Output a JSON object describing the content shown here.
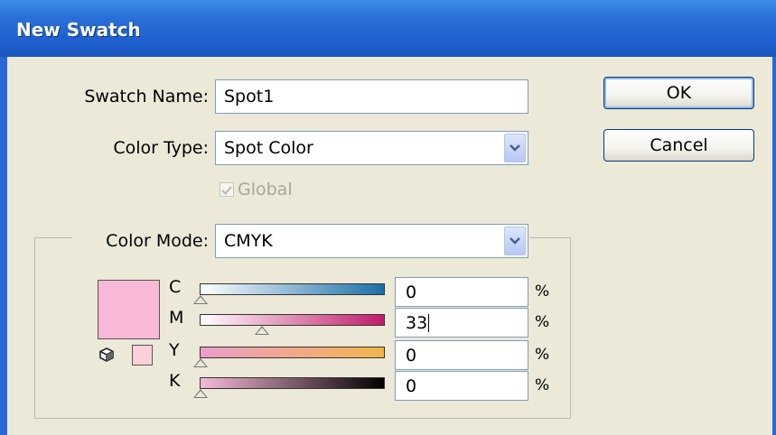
{
  "dialog": {
    "title": "New Swatch"
  },
  "swatch_name": {
    "label": "Swatch Name:",
    "value": "Spot1"
  },
  "color_type": {
    "label": "Color Type:",
    "value": "Spot Color"
  },
  "global": {
    "label": "Global",
    "checked": true,
    "enabled": false
  },
  "color_mode": {
    "label": "Color Mode:",
    "value": "CMYK"
  },
  "buttons": {
    "ok": "OK",
    "cancel": "Cancel"
  },
  "channels": [
    {
      "name": "C",
      "value": "0",
      "unit": "%",
      "percent": 0,
      "gradient": [
        "#ffffff",
        "#1b6fa8"
      ]
    },
    {
      "name": "M",
      "value": "33",
      "unit": "%",
      "percent": 33,
      "gradient": [
        "#ffffff",
        "#c21a6b"
      ]
    },
    {
      "name": "Y",
      "value": "0",
      "unit": "%",
      "percent": 0,
      "gradient": [
        "#ee9ccb",
        "#f0b54a"
      ]
    },
    {
      "name": "K",
      "value": "0",
      "unit": "%",
      "percent": 0,
      "gradient": [
        "#f7b9d7",
        "#000000"
      ]
    }
  ],
  "colors": {
    "preview": "#f7b9d7",
    "titlebar": "#1d5fcc",
    "dialog_bg": "#ece9d8"
  }
}
